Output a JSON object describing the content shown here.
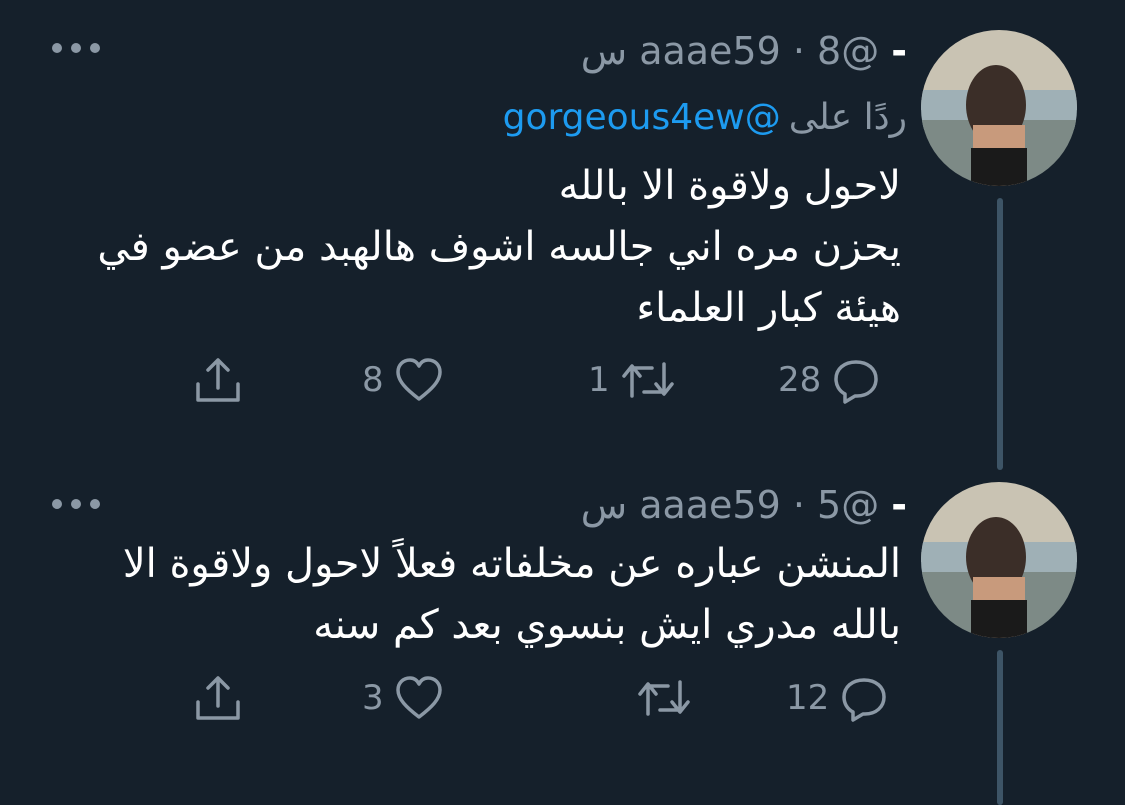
{
  "tweets": [
    {
      "handle": "@aaae59",
      "time": "8 س",
      "reply_prefix": "ردًا على",
      "reply_mention": "@gorgeous4ew",
      "lines": [
        "لاحول ولاقوة الا بالله",
        "يحزن مره اني جالسه اشوف هالهبد من عضو في",
        "هيئة كبار العلماء"
      ],
      "replies": "28",
      "retweets": "1",
      "likes": "8"
    },
    {
      "handle": "@aaae59",
      "time": "5 س",
      "lines": [
        "المنشن عباره عن مخلفاته فعلاً لاحول ولاقوة الا",
        "بالله مدري ايش بنسوي بعد كم سنه"
      ],
      "replies": "12",
      "retweets": "",
      "likes": "3"
    }
  ],
  "colors": {
    "background": "#15202b",
    "text": "#ffffff",
    "secondary": "#8b98a5",
    "link": "#1d9bf0",
    "thread_line": "#3d5466"
  },
  "icons": [
    "more-icon",
    "reply-icon",
    "retweet-icon",
    "like-icon",
    "share-icon"
  ]
}
